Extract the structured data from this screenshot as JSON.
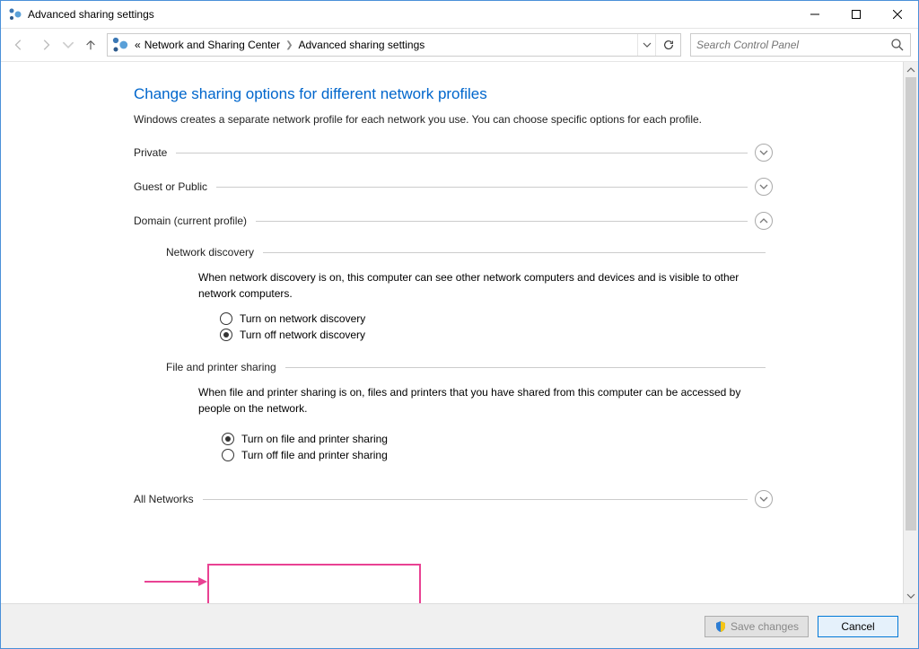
{
  "window": {
    "title": "Advanced sharing settings"
  },
  "toolbar": {
    "breadcrumb_prefix": "«",
    "crumb1": "Network and Sharing Center",
    "crumb2": "Advanced sharing settings",
    "search_placeholder": "Search Control Panel"
  },
  "page": {
    "heading": "Change sharing options for different network profiles",
    "intro": "Windows creates a separate network profile for each network you use. You can choose specific options for each profile."
  },
  "sections": {
    "private": "Private",
    "guest": "Guest or Public",
    "domain": "Domain (current profile)",
    "all_networks": "All Networks"
  },
  "domain": {
    "network_discovery": {
      "label": "Network discovery",
      "desc": "When network discovery is on, this computer can see other network computers and devices and is visible to other network computers.",
      "opt_on": "Turn on network discovery",
      "opt_off": "Turn off network discovery"
    },
    "file_printer": {
      "label": "File and printer sharing",
      "desc": "When file and printer sharing is on, files and printers that you have shared from this computer can be accessed by people on the network.",
      "opt_on": "Turn on file and printer sharing",
      "opt_off": "Turn off file and printer sharing"
    }
  },
  "footer": {
    "save": "Save changes",
    "cancel": "Cancel"
  }
}
